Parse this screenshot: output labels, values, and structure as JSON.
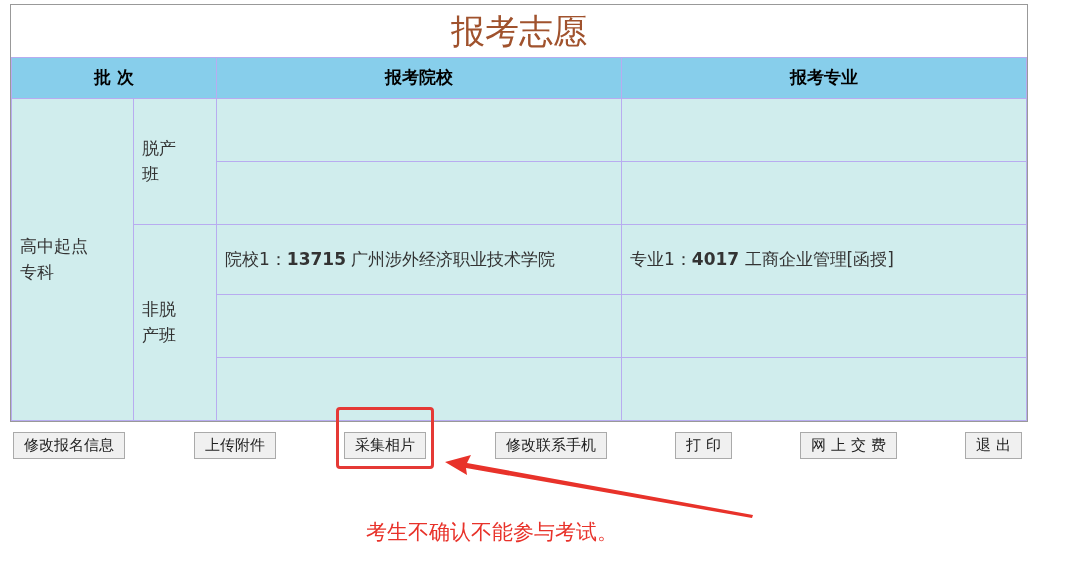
{
  "title": "报考志愿",
  "columns": [
    "批 次",
    "报考院校",
    "报考专业"
  ],
  "batches": [
    {
      "name": "高中起点专科",
      "classes": [
        {
          "name": "脱产班"
        },
        {
          "name": "非脱产班",
          "slots": [
            {
              "school": "院校1：**13715**  广州涉外经济职业技术学院",
              "major": "专业1：**4017** 工商企业管理[函授]"
            }
          ]
        }
      ]
    }
  ],
  "buttons": [
    {
      "label": "修改报名信息",
      "highlighted": false
    },
    {
      "label": "上传附件",
      "highlighted": false
    },
    {
      "label": "采集相片",
      "highlighted": true
    },
    {
      "label": "修改联系手机",
      "highlighted": false
    },
    {
      "label": "打 印",
      "highlighted": false
    },
    {
      "label": "网 上 交 费",
      "highlighted": false
    },
    {
      "label": "退 出",
      "highlighted": false
    }
  ],
  "annotation": "考生不确认不能参与考试。"
}
